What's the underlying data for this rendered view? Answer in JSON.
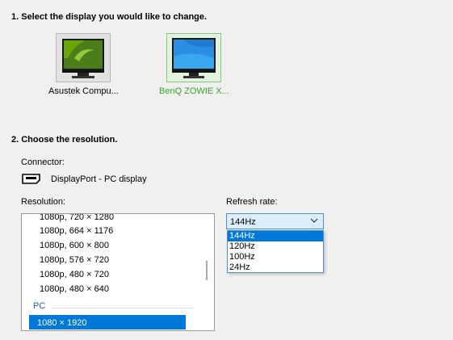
{
  "step1": {
    "title": "1. Select the display you would like to change."
  },
  "displays": [
    {
      "label": "Asustek Compu...",
      "icon": "nvidia-monitor-icon",
      "selected": false
    },
    {
      "label": "BenQ ZOWIE X...",
      "icon": "windows-monitor-icon",
      "selected": true
    }
  ],
  "step2": {
    "title": "2. Choose the resolution."
  },
  "connector": {
    "label": "Connector:",
    "value": "DisplayPort - PC display",
    "icon": "displayport-icon"
  },
  "resolution": {
    "label": "Resolution:",
    "items": [
      "1080p, 720 × 1280",
      "1080p, 664 × 1176",
      "1080p, 600 × 800",
      "1080p, 576 × 720",
      "1080p, 480 × 720",
      "1080p, 480 × 640"
    ],
    "group_header": "PC",
    "selected": "1080 × 1920"
  },
  "refresh": {
    "label": "Refresh rate:",
    "selected": "144Hz",
    "options": [
      "144Hz",
      "120Hz",
      "100Hz",
      "24Hz"
    ]
  },
  "colors": {
    "accent": "#0078d7",
    "selected_display_text": "#3aa02a",
    "group_header": "#1f5fb4"
  }
}
